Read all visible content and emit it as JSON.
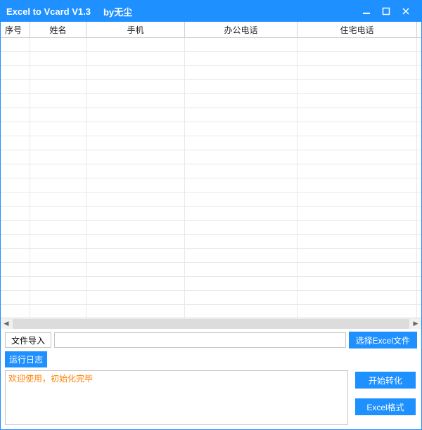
{
  "titlebar": {
    "title": "Excel to Vcard V1.3",
    "author": "by无尘"
  },
  "grid": {
    "columns": [
      "序号",
      "姓名",
      "手机",
      "办公电话",
      "住宅电话"
    ],
    "rows": []
  },
  "file_import": {
    "label": "文件导入",
    "path": "",
    "choose_button": "选择Excel文件"
  },
  "log": {
    "label": "运行日志",
    "content": "欢迎使用，初始化完毕"
  },
  "actions": {
    "start": "开始转化",
    "format": "Excel格式"
  }
}
